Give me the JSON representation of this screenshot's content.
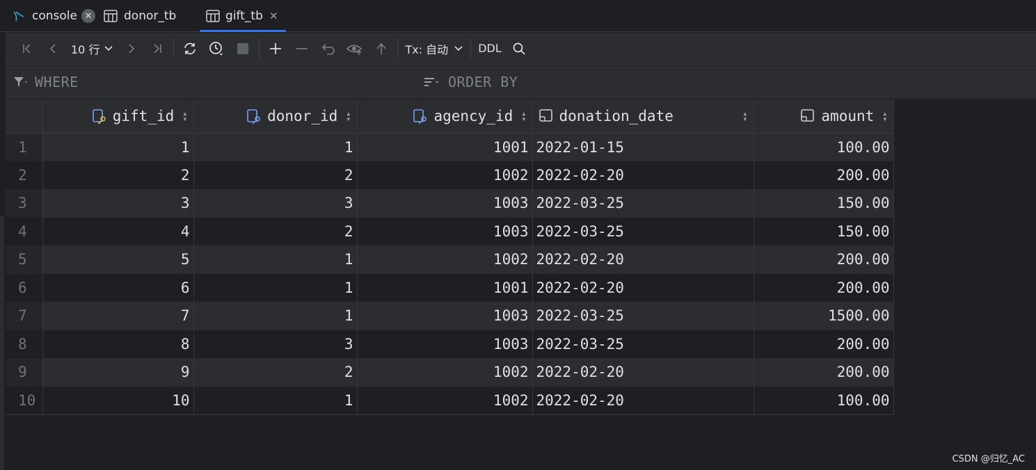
{
  "tabs": [
    {
      "label": "console",
      "icon": "console-icon",
      "active": false
    },
    {
      "label": "donor_tb",
      "icon": "table-icon",
      "active": false
    },
    {
      "label": "gift_tb",
      "icon": "table-icon",
      "active": true
    }
  ],
  "toolbar": {
    "rows_label": "10 行",
    "tx_label": "Tx: 自动",
    "ddl_label": "DDL"
  },
  "filter": {
    "where_label": "WHERE",
    "order_label": "ORDER BY"
  },
  "table": {
    "columns": [
      "gift_id",
      "donor_id",
      "agency_id",
      "donation_date",
      "amount"
    ],
    "rows": [
      {
        "n": "1",
        "gift_id": "1",
        "donor_id": "1",
        "agency_id": "1001",
        "donation_date": "2022-01-15",
        "amount": "100.00"
      },
      {
        "n": "2",
        "gift_id": "2",
        "donor_id": "2",
        "agency_id": "1002",
        "donation_date": "2022-02-20",
        "amount": "200.00"
      },
      {
        "n": "3",
        "gift_id": "3",
        "donor_id": "3",
        "agency_id": "1003",
        "donation_date": "2022-03-25",
        "amount": "150.00"
      },
      {
        "n": "4",
        "gift_id": "4",
        "donor_id": "2",
        "agency_id": "1003",
        "donation_date": "2022-03-25",
        "amount": "150.00"
      },
      {
        "n": "5",
        "gift_id": "5",
        "donor_id": "1",
        "agency_id": "1002",
        "donation_date": "2022-02-20",
        "amount": "200.00"
      },
      {
        "n": "6",
        "gift_id": "6",
        "donor_id": "1",
        "agency_id": "1001",
        "donation_date": "2022-02-20",
        "amount": "200.00"
      },
      {
        "n": "7",
        "gift_id": "7",
        "donor_id": "1",
        "agency_id": "1003",
        "donation_date": "2022-03-25",
        "amount": "1500.00"
      },
      {
        "n": "8",
        "gift_id": "8",
        "donor_id": "3",
        "agency_id": "1003",
        "donation_date": "2022-03-25",
        "amount": "200.00"
      },
      {
        "n": "9",
        "gift_id": "9",
        "donor_id": "2",
        "agency_id": "1002",
        "donation_date": "2022-02-20",
        "amount": "200.00"
      },
      {
        "n": "10",
        "gift_id": "10",
        "donor_id": "1",
        "agency_id": "1002",
        "donation_date": "2022-02-20",
        "amount": "100.00"
      }
    ]
  },
  "watermark": "CSDN @归忆_AC",
  "colors": {
    "accent": "#3574f0",
    "bg": "#1e1f22",
    "panel": "#2b2d30",
    "key_icon": "#e8b545"
  }
}
